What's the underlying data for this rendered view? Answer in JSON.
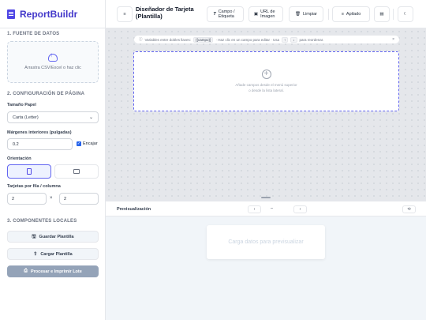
{
  "app": {
    "name": "ReportBuildr"
  },
  "sidebar": {
    "section1_title": "1. FUENTE DE DATOS",
    "dropzone_text": "Arrastra CSV/Excel o haz clic",
    "section2_title": "2. CONFIGURACIÓN DE PÁGINA",
    "paper_label": "Tamaño Papel",
    "paper_value": "Carta (Letter)",
    "margins_label": "Márgenes interiores (pulgadas)",
    "margins_value": "0.2",
    "fit_label": "Encajar",
    "orientation_label": "Orientación",
    "grid_label": "Tarjetas por fila / columna",
    "grid_cols": "2",
    "grid_times": "×",
    "grid_rows": "2",
    "section3_title": "3. COMPONENTES LOCALES",
    "save_label": "Guardar Plantilla",
    "load_label": "Cargar Plantilla",
    "process_label": "Procesar e Imprimir Lote"
  },
  "toolbar": {
    "menu_glyph": "≡",
    "title": "Diseñador de Tarjeta (Plantilla)",
    "field_label": "Campo / Etiqueta",
    "url_label": "URL de Imagen",
    "clear_label": "Limpiar",
    "align_label": "Apilado"
  },
  "canvas": {
    "hint_prefix": "Variables entre dobles llaves:",
    "hint_code": "{{campo}}",
    "hint_mid": "· Haz clic en un campo para editar · Usa",
    "hint_up": "↑",
    "hint_down": "↓",
    "hint_suffix": "para reordenar.",
    "hint_close": "×",
    "empty_line1": "Añade campos desde el menú superior",
    "empty_line2": "o desde la lista lateral."
  },
  "preview": {
    "title": "Previsualización",
    "prev": "‹",
    "page": "–",
    "next": "›",
    "placeholder": "Carga datos para previsualizar"
  },
  "colors": {
    "accent": "#4f46e5",
    "process_btn": "#94a3b8"
  }
}
